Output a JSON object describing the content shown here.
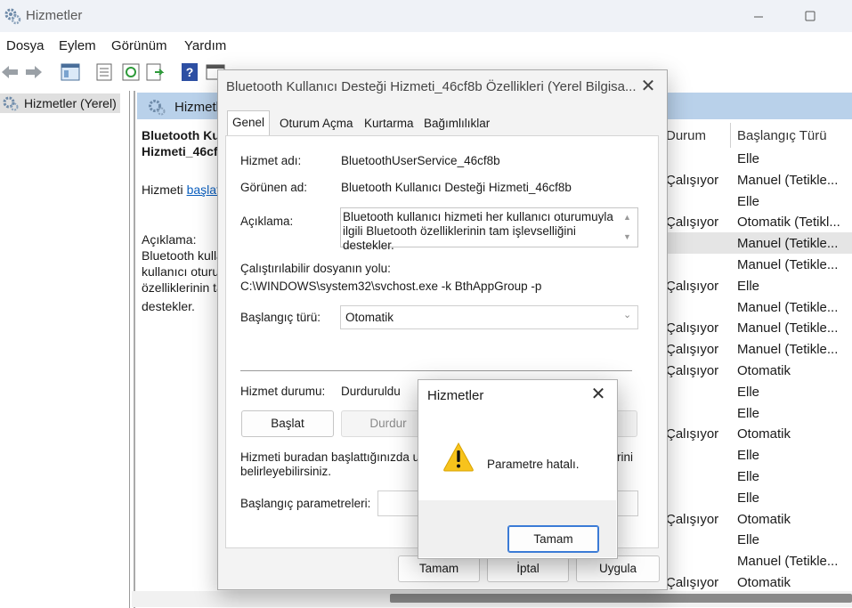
{
  "window": {
    "title": "Hizmetler"
  },
  "menu": [
    "Dosya",
    "Eylem",
    "Görünüm",
    "Yardım"
  ],
  "tree": {
    "root": "Hizmetler (Yerel)"
  },
  "panel": {
    "header": "Hizmetler (Yerel)",
    "name_line1": "Bluetooth Kullanıcı Desteği",
    "name_line2": "Hizmeti_46cf8b",
    "action_prefix": "Hizmeti ",
    "action_link": "başlatın",
    "desc_label": "Açıklama:",
    "desc_lines": [
      "Bluetooth kullanıcı hizmeti her",
      "kullanıcı oturumuyla ilgili Bluetooth",
      "özelliklerinin tam işlevselliğini",
      "destekler."
    ]
  },
  "services_list": {
    "columns": [
      "Durum",
      "Başlangıç Türü"
    ],
    "rows": [
      {
        "status": "",
        "startup": "Elle"
      },
      {
        "status": "Çalışıyor",
        "startup": "Manuel (Tetikle..."
      },
      {
        "status": "",
        "startup": "Elle"
      },
      {
        "status": "Çalışıyor",
        "startup": "Otomatik (Tetikl..."
      },
      {
        "status": "",
        "startup": "Manuel (Tetikle..."
      },
      {
        "status": "",
        "startup": "Manuel (Tetikle..."
      },
      {
        "status": "Çalışıyor",
        "startup": "Elle"
      },
      {
        "status": "",
        "startup": "Manuel (Tetikle..."
      },
      {
        "status": "Çalışıyor",
        "startup": "Manuel (Tetikle..."
      },
      {
        "status": "Çalışıyor",
        "startup": "Manuel (Tetikle..."
      },
      {
        "status": "Çalışıyor",
        "startup": "Otomatik"
      },
      {
        "status": "",
        "startup": "Elle"
      },
      {
        "status": "",
        "startup": "Elle"
      },
      {
        "status": "Çalışıyor",
        "startup": "Otomatik"
      },
      {
        "status": "",
        "startup": "Elle"
      },
      {
        "status": "",
        "startup": "Elle"
      },
      {
        "status": "",
        "startup": "Elle"
      },
      {
        "status": "Çalışıyor",
        "startup": "Otomatik"
      },
      {
        "status": "",
        "startup": "Elle"
      },
      {
        "status": "",
        "startup": "Manuel (Tetikle..."
      },
      {
        "status": "Çalışıyor",
        "startup": "Otomatik"
      }
    ]
  },
  "props": {
    "title": "Bluetooth Kullanıcı Desteği Hizmeti_46cf8b Özellikleri (Yerel Bilgisa...",
    "tabs": [
      "Genel",
      "Oturum Açma",
      "Kurtarma",
      "Bağımlılıklar"
    ],
    "service_name_label": "Hizmet adı:",
    "service_name": "BluetoothUserService_46cf8b",
    "display_name_label": "Görünen ad:",
    "display_name": "Bluetooth Kullanıcı Desteği Hizmeti_46cf8b",
    "description_label": "Açıklama:",
    "description_line1": "Bluetooth kullanıcı hizmeti her kullanıcı oturumuyla",
    "description_line2": "ilgili Bluetooth özelliklerinin tam işlevselliğini destekler.",
    "path_label": "Çalıştırılabilir dosyanın yolu:",
    "path": "C:\\WINDOWS\\system32\\svchost.exe -k BthAppGroup -p",
    "startup_label": "Başlangıç türü:",
    "startup_value": "Otomatik",
    "status_label": "Hizmet durumu:",
    "status_value": "Durduruldu",
    "start_button": "Başlat",
    "stop_button": "Durdur",
    "hint_line1": "Hizmeti buradan başlattığınızda uy",
    "hint_line1_tail": "rini",
    "hint_line2": "belirleyebilirsiniz.",
    "params_label": "Başlangıç parametreleri:",
    "ok": "Tamam",
    "cancel": "İptal",
    "apply": "Uygula"
  },
  "error": {
    "title": "Hizmetler",
    "message": "Parametre hatalı.",
    "ok": "Tamam"
  },
  "colors": {
    "accent": "#3b7bd6",
    "header_bg": "#b9d1ea",
    "warning": "#f7c31c"
  }
}
